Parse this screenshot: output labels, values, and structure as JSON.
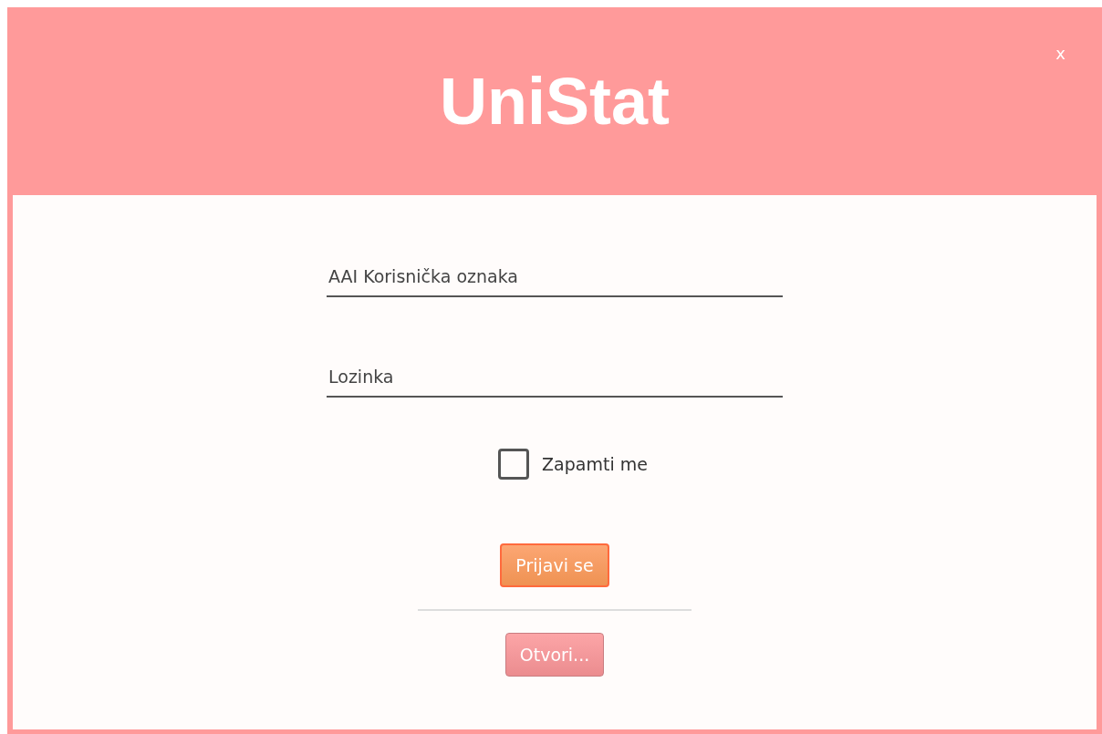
{
  "window": {
    "title": "UniStat",
    "close": "x"
  },
  "form": {
    "username": {
      "placeholder": "AAI Korisnička oznaka"
    },
    "password": {
      "placeholder": "Lozinka"
    },
    "remember": {
      "label": "Zapamti me",
      "checked": false
    },
    "buttons": [
      {
        "label": "Prijavi se",
        "kind": "primary"
      },
      {
        "label": "Otvori...",
        "kind": "secondary"
      }
    ]
  }
}
